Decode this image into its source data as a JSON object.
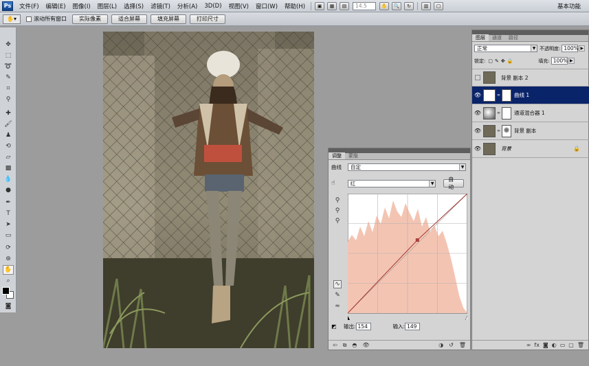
{
  "app": {
    "logo": "Ps",
    "workspace": "基本功能"
  },
  "menu": [
    "文件(F)",
    "编辑(E)",
    "图像(I)",
    "图层(L)",
    "选择(S)",
    "滤镜(T)",
    "分析(A)",
    "3D(D)",
    "视图(V)",
    "窗口(W)",
    "帮助(H)"
  ],
  "zoom": "14.5",
  "options": {
    "scroll_all_windows": "滚动所有窗口",
    "actual_pixels": "实际像素",
    "fit_screen": "适合屏幕",
    "fill_screen": "填充屏幕",
    "print_size": "打印尺寸"
  },
  "curves_panel": {
    "tabs": [
      "调整",
      "蒙版"
    ],
    "title": "曲线",
    "preset": "自定",
    "channel": "红",
    "auto_label": "自动",
    "output_label": "输出:",
    "output_value": "154",
    "input_label": "输入:",
    "input_value": "149",
    "colors": {
      "histogram": "#f4c4b2",
      "curve": "#a83f3a"
    }
  },
  "layers_panel": {
    "tabs": [
      "图层",
      "通道",
      "路径"
    ],
    "blend_mode": "正常",
    "opacity_label": "不透明度:",
    "opacity": "100%",
    "lock_label": "锁定:",
    "fill_label": "填充:",
    "fill": "100%",
    "layers": [
      {
        "name": "背景 副本 2",
        "visible": false,
        "selected": false
      },
      {
        "name": "曲线 1",
        "visible": true,
        "selected": true
      },
      {
        "name": "通道混合器 1",
        "visible": true,
        "selected": false
      },
      {
        "name": "背景 副本",
        "visible": true,
        "selected": false
      },
      {
        "name": "背景",
        "visible": true,
        "selected": false
      }
    ]
  }
}
